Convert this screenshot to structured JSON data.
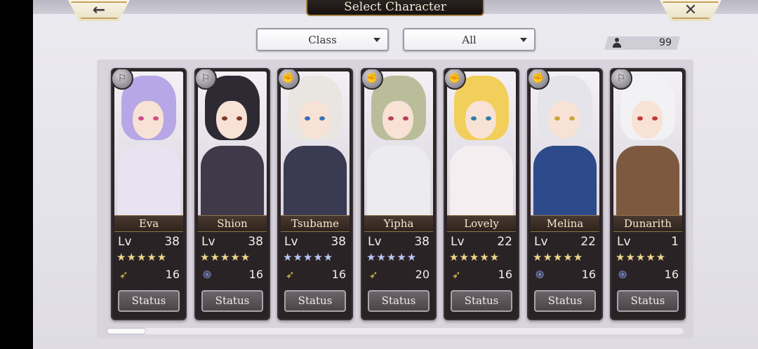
{
  "header": {
    "title": "Select Character",
    "back_icon": "←",
    "close_icon": "✕"
  },
  "filters": {
    "class_label": "Class",
    "all_label": "All"
  },
  "roster_count": "99",
  "status_label": "Status",
  "lv_label": "Lv",
  "characters": [
    {
      "name": "Eva",
      "level": "38",
      "stars": "★★★★★",
      "star_color": "gold",
      "element": "wind",
      "element_glyph": "➶",
      "value": "16",
      "emblem": "⚐",
      "hair": "#b7a7e6",
      "body": "#e9e3f1",
      "eye": "#d14b8a"
    },
    {
      "name": "Shion",
      "level": "38",
      "stars": "★★★★★",
      "star_color": "gold",
      "element": "swirl",
      "element_glyph": "֍",
      "value": "16",
      "emblem": "⚐",
      "hair": "#2e2a33",
      "body": "#3e3a4a",
      "eye": "#7a3a2a"
    },
    {
      "name": "Tsubame",
      "level": "38",
      "stars": "★★★★★",
      "star_color": "blue",
      "element": "wind",
      "element_glyph": "➶",
      "value": "16",
      "emblem": "✊",
      "hair": "#e9e6e2",
      "body": "#3a3b52",
      "eye": "#3b6fb8"
    },
    {
      "name": "Yipha",
      "level": "38",
      "stars": "★★★★★",
      "star_color": "blue",
      "element": "wind",
      "element_glyph": "➶",
      "value": "20",
      "emblem": "✊",
      "hair": "#b9bd9a",
      "body": "#ecebee",
      "eye": "#b84057"
    },
    {
      "name": "Lovely",
      "level": "22",
      "stars": "★★★★★",
      "star_color": "gold",
      "element": "wind",
      "element_glyph": "➶",
      "value": "16",
      "emblem": "✊",
      "hair": "#f1cf5a",
      "body": "#f4eef0",
      "eye": "#2e7fa6"
    },
    {
      "name": "Melina",
      "level": "22",
      "stars": "★★★★★",
      "star_color": "gold",
      "element": "swirl",
      "element_glyph": "֍",
      "value": "16",
      "emblem": "✊",
      "hair": "#e4e4ea",
      "body": "#2d4a8a",
      "eye": "#c9a43a"
    },
    {
      "name": "Dunarith",
      "level": "1",
      "stars": "★★★★★",
      "star_color": "gold",
      "element": "swirl",
      "element_glyph": "֍",
      "value": "16",
      "emblem": "⚐",
      "hair": "#f2f1f4",
      "body": "#7d5a3f",
      "eye": "#c23a3a"
    }
  ]
}
